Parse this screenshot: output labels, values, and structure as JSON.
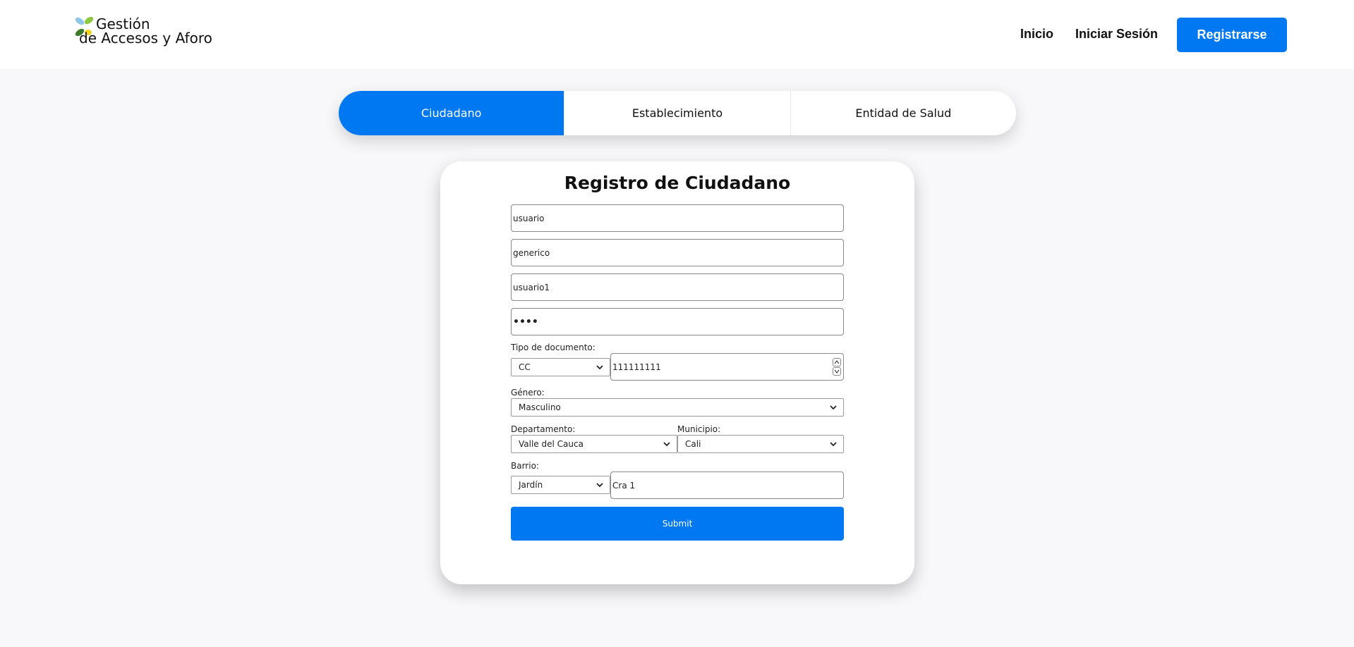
{
  "header": {
    "logo_line1": "Gestión",
    "logo_line2": "de Accesos y Aforo",
    "nav": {
      "home": "Inicio",
      "login": "Iniciar Sesión",
      "register": "Registrarse"
    }
  },
  "tabs": [
    {
      "label": "Ciudadano",
      "active": true
    },
    {
      "label": "Establecimiento",
      "active": false
    },
    {
      "label": "Entidad de Salud",
      "active": false
    }
  ],
  "form": {
    "title": "Registro de Ciudadano",
    "first_name": "usuario",
    "last_name": "generico",
    "username": "usuario1",
    "password_masked": "••••",
    "doc_type_label": "Tipo de documento:",
    "doc_type_value": "CC",
    "doc_number": "111111111",
    "gender_label": "Género:",
    "gender_value": "Masculino",
    "department_label": "Departamento:",
    "department_value": "Valle del Cauca",
    "municipality_label": "Municipio:",
    "municipality_value": "Cali",
    "neighborhood_label": "Barrio:",
    "neighborhood_value": "Jardín",
    "address": "Cra 1",
    "submit_label": "Submit"
  },
  "colors": {
    "primary": "#0078f2",
    "background": "#f8f8fa"
  },
  "icons": [
    "logo-leaves-icon",
    "chevron-down-icon",
    "spinner-up-icon",
    "spinner-down-icon"
  ]
}
